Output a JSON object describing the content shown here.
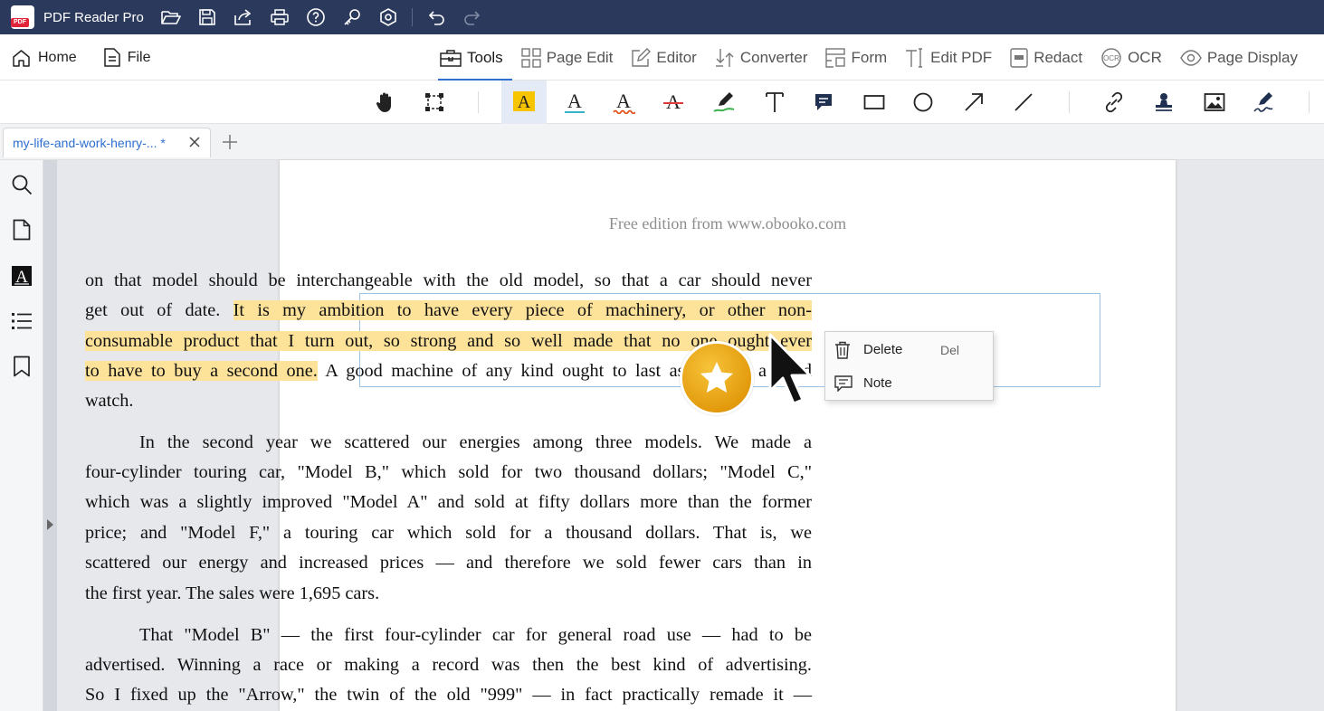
{
  "titlebar": {
    "app_title": "PDF Reader Pro",
    "logo_text": "PDF",
    "bg": "#2b3a5c",
    "icons": [
      "folder-open-icon",
      "save-icon",
      "share-icon",
      "print-icon",
      "help-icon",
      "key-icon",
      "settings-icon",
      "undo-icon",
      "redo-icon"
    ]
  },
  "menubar": {
    "home_label": "Home",
    "file_label": "File",
    "tabs": [
      {
        "label": "Tools",
        "icon": "toolbox-icon",
        "active": true
      },
      {
        "label": "Page Edit",
        "icon": "grid-icon"
      },
      {
        "label": "Editor",
        "icon": "edit-icon"
      },
      {
        "label": "Converter",
        "icon": "convert-icon"
      },
      {
        "label": "Form",
        "icon": "form-icon"
      },
      {
        "label": "Edit PDF",
        "icon": "text-cursor-icon"
      },
      {
        "label": "Redact",
        "icon": "redact-icon"
      },
      {
        "label": "OCR",
        "icon": "ocr-icon"
      },
      {
        "label": "Page Display",
        "icon": "eye-icon"
      }
    ],
    "accent": "#2f6fd0"
  },
  "tools": {
    "items": [
      "hand-icon",
      "marquee-select-icon",
      "highlight-icon",
      "underline-icon",
      "squiggly-icon",
      "strikeout-icon",
      "freehand-icon",
      "text-box-icon",
      "note-icon",
      "rectangle-icon",
      "circle-icon",
      "arrow-icon",
      "line-icon",
      "link-icon",
      "stamp-icon",
      "image-icon",
      "signature-icon"
    ],
    "active": "highlight-icon",
    "highlight_color": "#f7c400"
  },
  "document_tab": {
    "label": "my-life-and-work-henry-... *",
    "add_label": "+"
  },
  "sidebar": {
    "items": [
      "search-icon",
      "page-icon",
      "annotation-icon",
      "outline-icon",
      "bookmark-icon"
    ]
  },
  "page": {
    "header": "Free edition from www.obooko.com",
    "p1": [
      {
        "plain": "on that model should be interchangeable with the old model, so that a car should never"
      },
      {
        "plain": "get out of date. ",
        "highlight": "It is my ambition to have every piece of machinery, or other non-"
      },
      {
        "highlight": "consumable product that I turn out, so strong and so well made that no one ought ever"
      },
      {
        "highlight": "to have to buy a second one.",
        "plain": " A good machine of any kind ought to last as long as a good"
      },
      {
        "plain": "watch."
      }
    ],
    "p2": [
      "In the second year we scattered our energies among three models. We made a",
      "four-cylinder touring car, \"Model B,\" which sold for two thousand dollars; \"Model C,\"",
      "which was a slightly improved \"Model A\" and sold at fifty dollars more than the former",
      "price; and \"Model F,\" a touring car which sold for a thousand dollars. That is, we",
      "scattered our energy and increased prices — and therefore we sold fewer cars than in",
      "the first year. The sales were 1,695 cars."
    ],
    "p3": [
      "That \"Model B\" — the first four-cylinder car for general road use — had to be",
      "advertised. Winning a race or making a record was then the best kind of advertising.",
      "So I fixed up the \"Arrow,\" the twin of the old \"999\" — in fact practically remade it —"
    ],
    "highlight_color": "#fde29a"
  },
  "context_menu": {
    "delete_label": "Delete",
    "delete_shortcut": "Del",
    "note_label": "Note"
  },
  "overlay": {
    "badge_icon": "star-icon",
    "badge_color": "#e8a411",
    "cursor_icon": "mouse-pointer-icon"
  }
}
